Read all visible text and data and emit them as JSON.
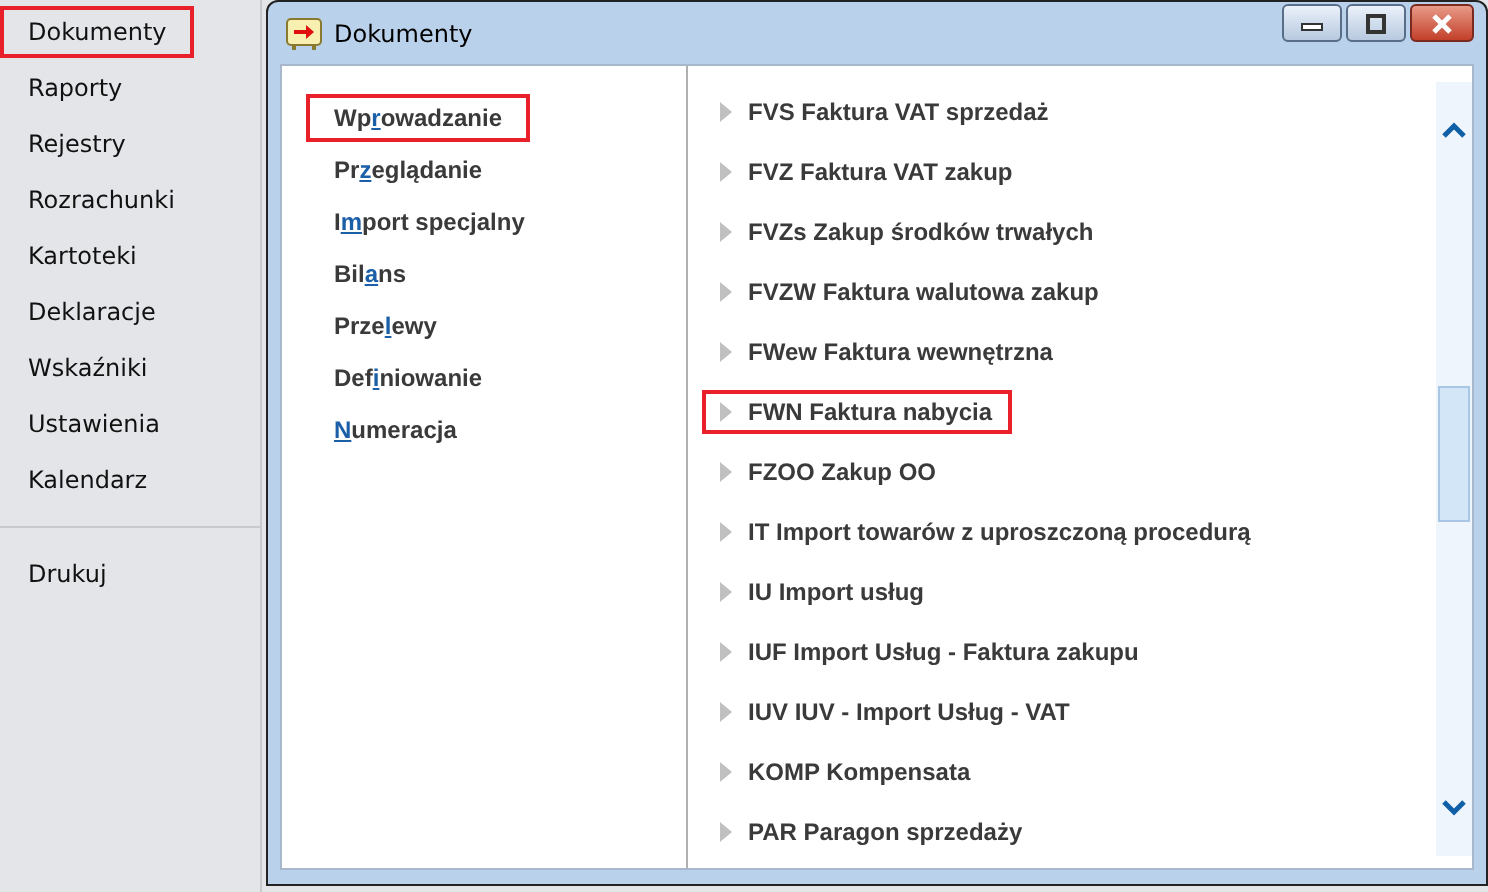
{
  "sidebar": {
    "items": [
      {
        "label": "Dokumenty",
        "highlighted": true
      },
      {
        "label": "Raporty",
        "highlighted": false
      },
      {
        "label": "Rejestry",
        "highlighted": false
      },
      {
        "label": "Rozrachunki",
        "highlighted": false
      },
      {
        "label": "Kartoteki",
        "highlighted": false
      },
      {
        "label": "Deklaracje",
        "highlighted": false
      },
      {
        "label": "Wskaźniki",
        "highlighted": false
      },
      {
        "label": "Ustawienia",
        "highlighted": false
      },
      {
        "label": "Kalendarz",
        "highlighted": false
      }
    ],
    "bottom_items": [
      {
        "label": "Drukuj",
        "highlighted": false
      }
    ]
  },
  "window": {
    "title": "Dokumenty",
    "menu": [
      {
        "before": "Wp",
        "key": "r",
        "after": "owadzanie",
        "highlighted": true
      },
      {
        "before": "Pr",
        "key": "z",
        "after": "eglądanie",
        "highlighted": false
      },
      {
        "before": "I",
        "key": "m",
        "after": "port specjalny",
        "highlighted": false
      },
      {
        "before": "Bil",
        "key": "a",
        "after": "ns",
        "highlighted": false
      },
      {
        "before": "Prze",
        "key": "l",
        "after": "ewy",
        "highlighted": false
      },
      {
        "before": "Def",
        "key": "i",
        "after": "niowanie",
        "highlighted": false
      },
      {
        "key": "N",
        "after": "umeracja",
        "highlighted": false
      }
    ],
    "documents": [
      {
        "label": "FVS Faktura VAT sprzedaż",
        "highlighted": false
      },
      {
        "label": "FVZ Faktura VAT zakup",
        "highlighted": false
      },
      {
        "label": "FVZs Zakup środków trwałych",
        "highlighted": false
      },
      {
        "label": "FVZW Faktura walutowa zakup",
        "highlighted": false
      },
      {
        "label": "FWew Faktura wewnętrzna",
        "highlighted": false
      },
      {
        "label": "FWN Faktura nabycia",
        "highlighted": true
      },
      {
        "label": "FZOO Zakup OO",
        "highlighted": false
      },
      {
        "label": "IT Import towarów z uproszczoną procedurą",
        "highlighted": false
      },
      {
        "label": "IU Import usług",
        "highlighted": false
      },
      {
        "label": "IUF Import Usług - Faktura zakupu",
        "highlighted": false
      },
      {
        "label": "IUV IUV - Import Usług - VAT",
        "highlighted": false
      },
      {
        "label": "KOMP Kompensata",
        "highlighted": false
      },
      {
        "label": "PAR Paragon sprzedaży",
        "highlighted": false
      }
    ]
  }
}
